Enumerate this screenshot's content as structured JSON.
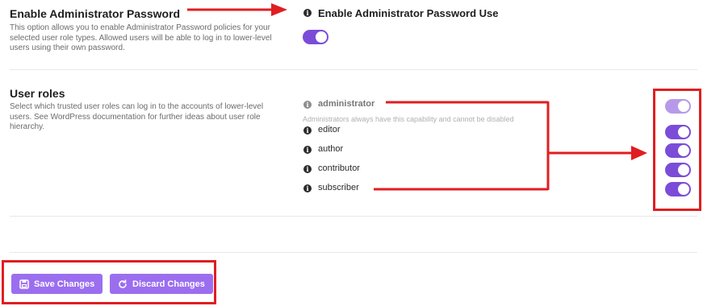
{
  "admin_password": {
    "title": "Enable Administrator Password",
    "description_lines": [
      "This option allows you to enable Administrator Password policies for your",
      "selected user role types. Allowed users will be able to log in to lower-level",
      "users using their own password."
    ],
    "option_label": "Enable Administrator Password Use",
    "enabled": true
  },
  "user_roles": {
    "title": "User roles",
    "description_lines": [
      "Select which trusted user roles can log in to the accounts of lower-level",
      "users. See WordPress documentation for further ideas about user role",
      "hierarchy."
    ],
    "roles": [
      {
        "label": "administrator",
        "enabled": true,
        "disabled": true,
        "hint": "Administrators always have this capability and cannot be disabled"
      },
      {
        "label": "editor",
        "enabled": true
      },
      {
        "label": "author",
        "enabled": true
      },
      {
        "label": "contributor",
        "enabled": true
      },
      {
        "label": "subscriber",
        "enabled": true
      }
    ]
  },
  "actions": {
    "save_label": "Save Changes",
    "discard_label": "Discard Changes"
  },
  "colors": {
    "accent": "#7b4cd8",
    "accent_disabled": "#b69ae9",
    "button": "#9b6ef0",
    "annotation": "#e01e22"
  }
}
